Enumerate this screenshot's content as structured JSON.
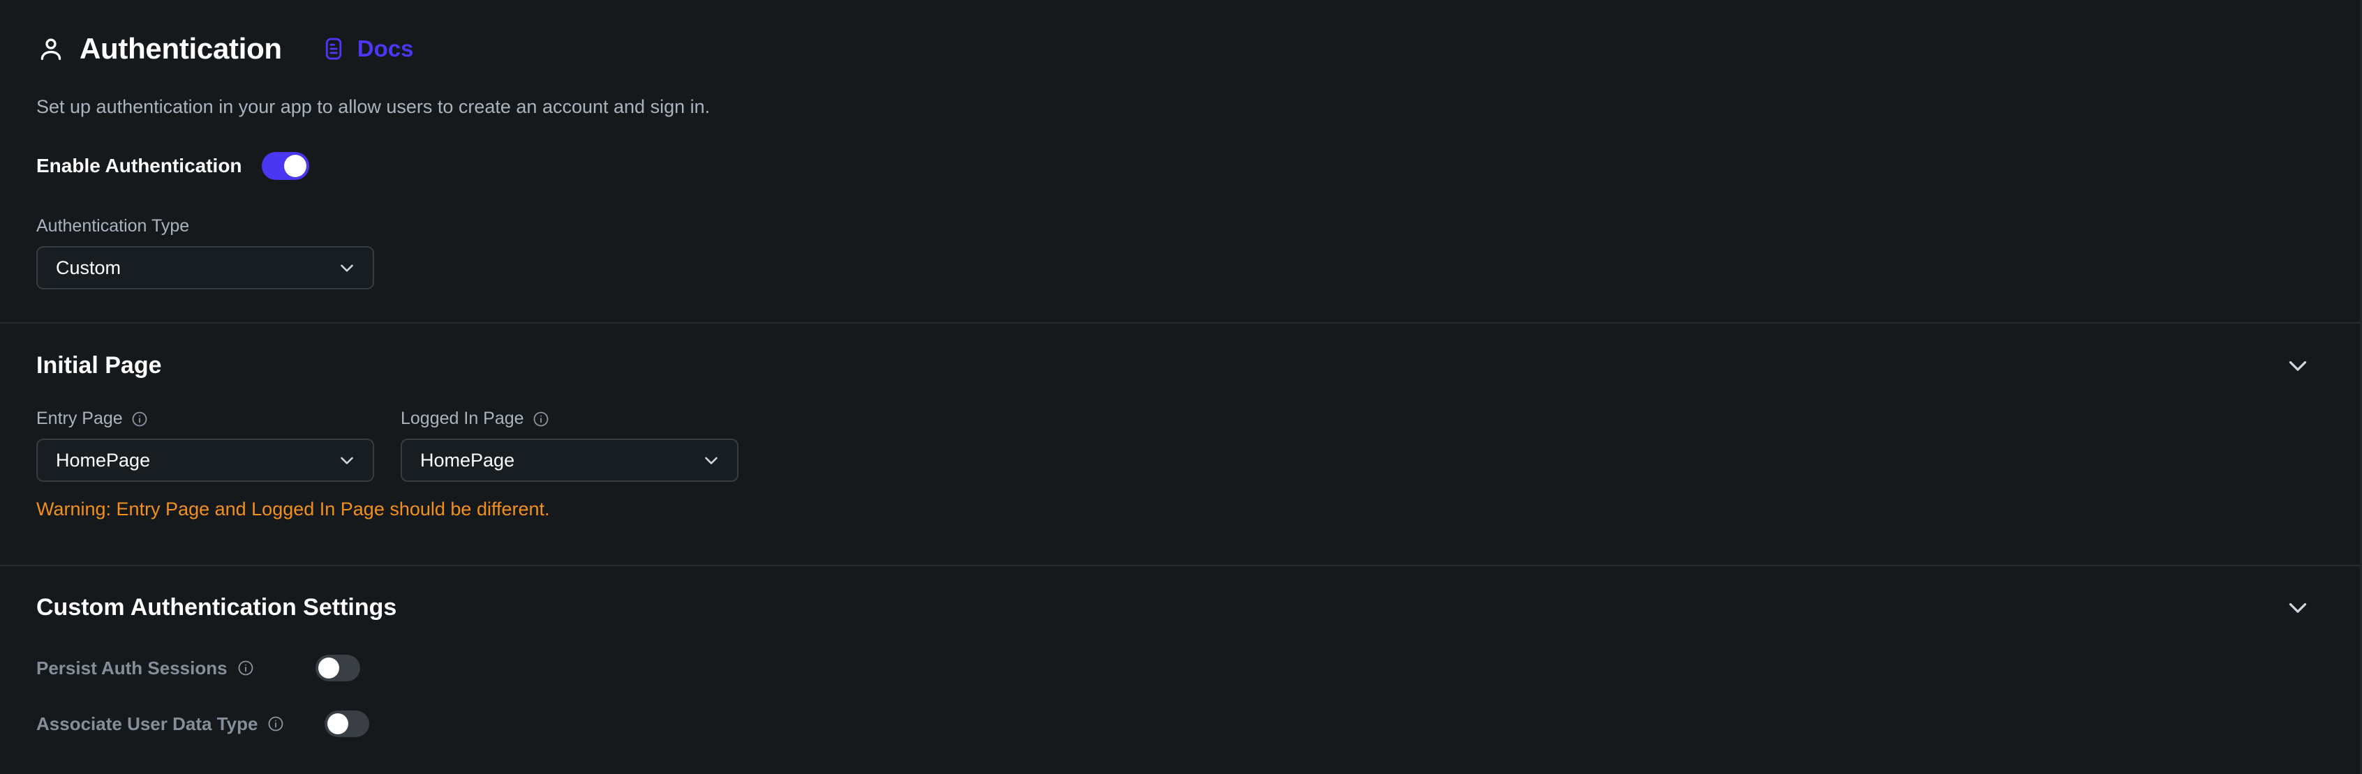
{
  "header": {
    "user_icon": "user-icon",
    "title": "Authentication",
    "docs_icon": "document-icon",
    "docs_label": "Docs"
  },
  "subtitle": "Set up authentication in your app to allow users to create an account and sign in.",
  "enable": {
    "label": "Enable Authentication",
    "toggle_state": "on"
  },
  "auth_type": {
    "label": "Authentication Type",
    "value": "Custom",
    "chevron_icon": "chevron-down-icon"
  },
  "initial_page": {
    "title": "Initial Page",
    "collapse_icon": "chevron-down-icon",
    "entry_page": {
      "label": "Entry Page",
      "info_icon": "info-icon",
      "value": "HomePage",
      "chevron_icon": "chevron-down-icon"
    },
    "logged_in_page": {
      "label": "Logged In Page",
      "info_icon": "info-icon",
      "value": "HomePage",
      "chevron_icon": "chevron-down-icon"
    },
    "warning": "Warning: Entry Page and Logged In Page should be different."
  },
  "custom_settings": {
    "title": "Custom Authentication Settings",
    "collapse_icon": "chevron-down-icon",
    "rows": [
      {
        "label": "Persist Auth Sessions",
        "info_icon": "info-icon",
        "toggle_state": "off"
      },
      {
        "label": "Associate User Data Type",
        "info_icon": "info-icon",
        "toggle_state": "off"
      }
    ]
  },
  "colors": {
    "background": "#15191c",
    "accent": "#4b37f5",
    "warning": "#f39019",
    "text_primary": "#ffffff",
    "text_muted": "#a9b4bf",
    "toggle_off_track": "#3a3f45"
  }
}
